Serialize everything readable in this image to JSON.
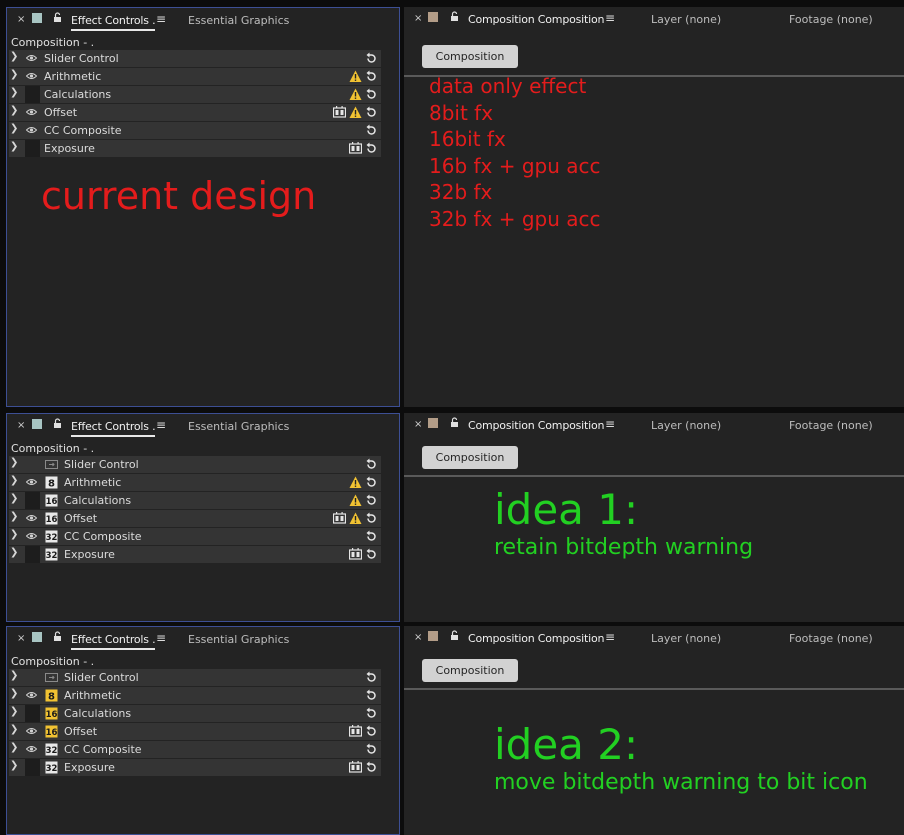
{
  "effect_controls_tab": "Effect Controls .",
  "essential_graphics_tab": "Essential Graphics",
  "composition_tab": "Composition Composition",
  "layer_tab": "Layer (none)",
  "footage_tab": "Footage (none)",
  "composition_button": "Composition",
  "comp_label": "Composition - .",
  "effects": [
    "Slider Control",
    "Arithmetic",
    "Calculations",
    "Offset",
    "CC Composite",
    "Exposure"
  ],
  "bit_labels": {
    "8": "8",
    "16": "16",
    "32": "32"
  },
  "current": {
    "heading": "current design",
    "legend": [
      "data only effect",
      "8bit fx",
      "16bit fx",
      "16b fx + gpu acc",
      "32b fx",
      "32b fx + gpu acc"
    ]
  },
  "idea1": {
    "title": "idea 1:",
    "subtitle": "retain bitdepth warning"
  },
  "idea2": {
    "title": "idea 2:",
    "subtitle": "move bitdepth warning to bit icon"
  },
  "colors": {
    "annotation_red": "#e41c1c",
    "annotation_green": "#22d022",
    "warning_yellow": "#f1c232"
  }
}
